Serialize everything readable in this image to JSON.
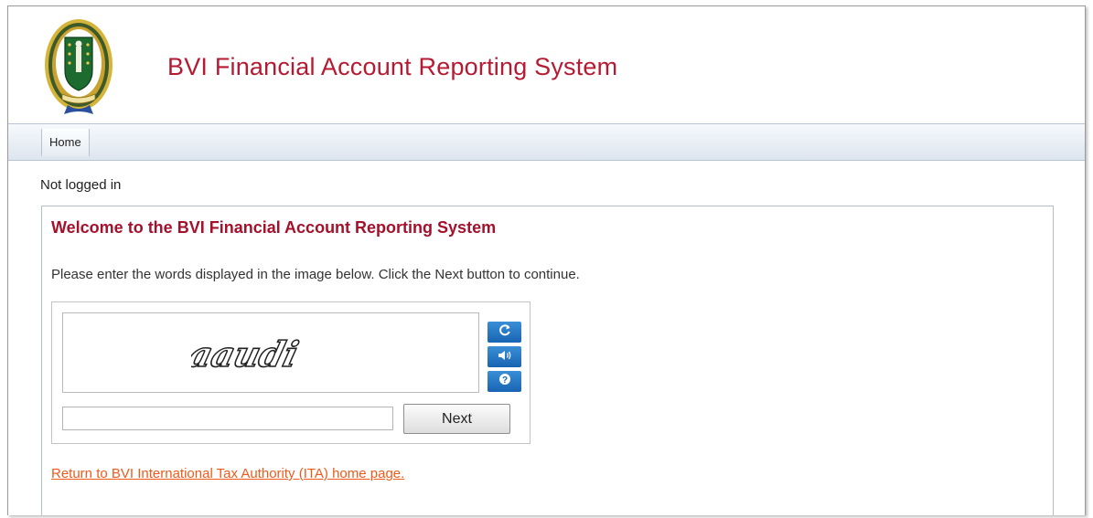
{
  "header": {
    "title": "BVI Financial Account Reporting System",
    "crest_motto": "VIGILATE"
  },
  "nav": {
    "items": [
      {
        "label": "Home"
      }
    ]
  },
  "status": {
    "login": "Not logged in"
  },
  "main": {
    "heading": "Welcome to the BVI Financial Account Reporting System",
    "instruction": "Please enter the words displayed in the image below. Click the Next button to continue.",
    "captcha": {
      "image_text": "aaudi",
      "input_value": "",
      "refresh_icon": "refresh-icon",
      "audio_icon": "speaker-icon",
      "help_icon": "help-icon",
      "next_label": "Next"
    },
    "return_link": "Return to BVI International Tax Authority (ITA) home page."
  },
  "colors": {
    "title_red": "#b51a33",
    "heading_red": "#a5102b",
    "link_orange": "#ef5a1a",
    "captcha_button_blue": "#1864b3"
  }
}
